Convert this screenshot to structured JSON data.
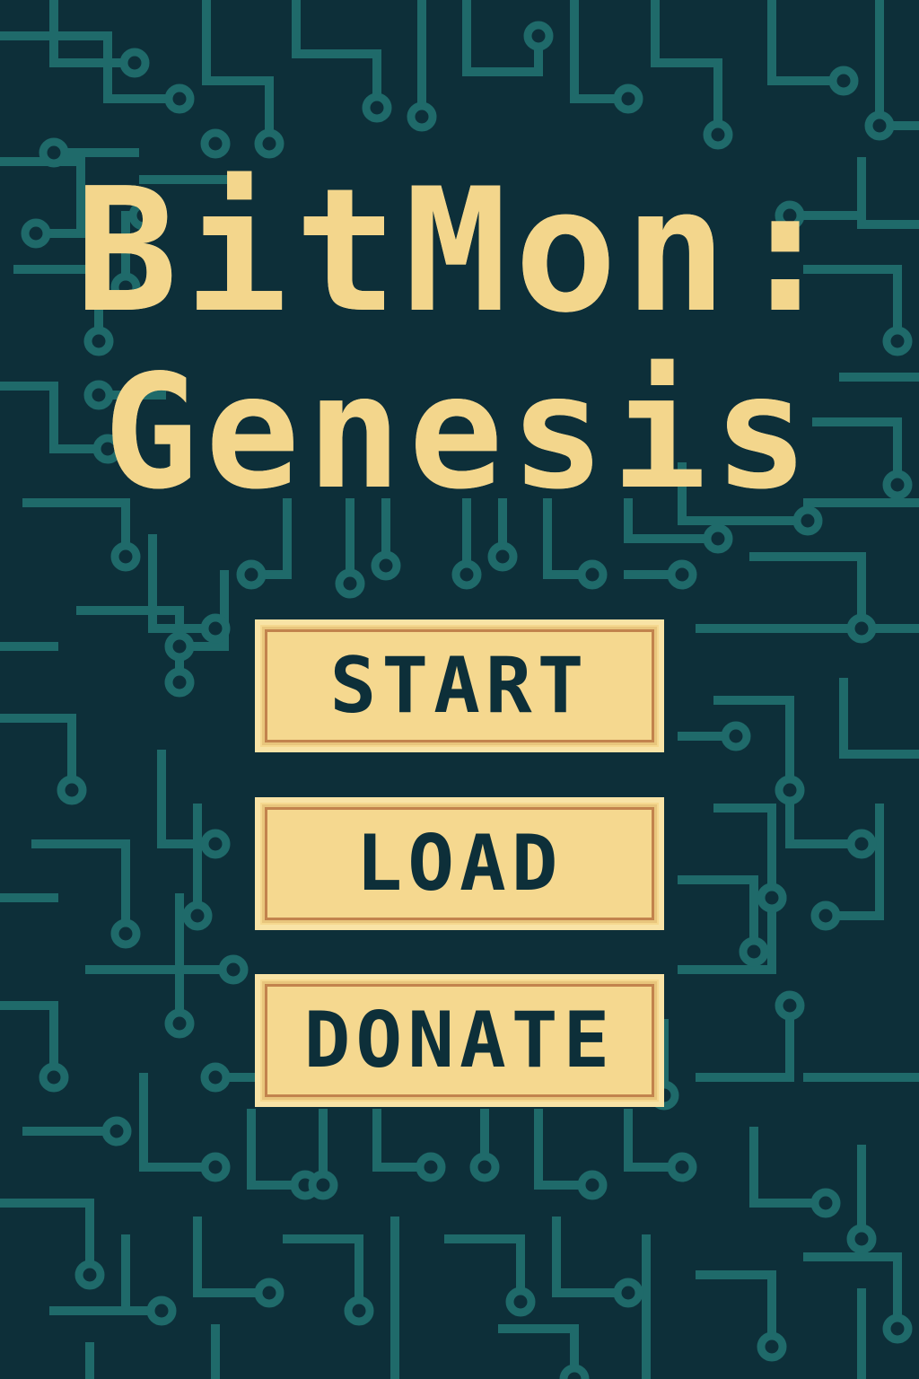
{
  "title": {
    "line1": "BitMon:",
    "line2": "Genesis"
  },
  "menu": {
    "start_label": "START",
    "load_label": "LOAD",
    "donate_label": "DONATE"
  },
  "colors": {
    "background": "#0d2f39",
    "circuit_trace": "#1f6a6a",
    "title_text": "#f3d68c",
    "button_fill": "#f5d88f",
    "button_border": "#c2834d",
    "button_text": "#0d2f39"
  },
  "background_icon": "circuit-board-pattern"
}
